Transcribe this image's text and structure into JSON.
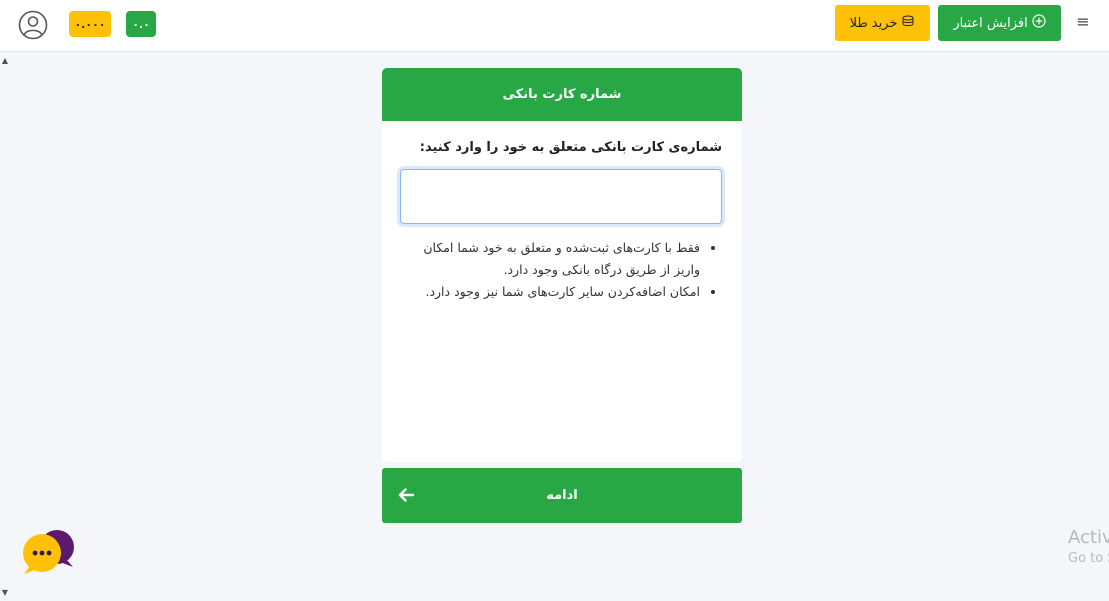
{
  "header": {
    "gold_balance": "۰.۰۰۰",
    "credit_balance": "۰.۰",
    "buy_gold_label": "خرید طلا",
    "increase_credit_label": "افزایش اعتبار"
  },
  "card": {
    "title": "شماره کارت بانکی",
    "prompt": "شماره‌ی کارت بانکی متعلق به خود را وارد کنید:",
    "input_value": "",
    "notes": [
      "فقط با کارت‌های ثبت‌شده و متعلق به خود شما امکان واریز از طریق درگاه بانکی وجود دارد.",
      "امکان اضافه‌کردن سایر کارت‌های شما نیز وجود دارد."
    ]
  },
  "continue_label": "ادامه",
  "watermark": {
    "title": "Activate Windows",
    "subtitle": "Go to Settings to activate Windows."
  },
  "colors": {
    "primary_green": "#28a745",
    "gold": "#ffc107",
    "background": "#f5f6fa"
  },
  "icons": [
    "user-circle-icon",
    "coins-icon",
    "plus-circle-icon",
    "menu-icon",
    "arrow-left-icon",
    "chat-icon"
  ]
}
